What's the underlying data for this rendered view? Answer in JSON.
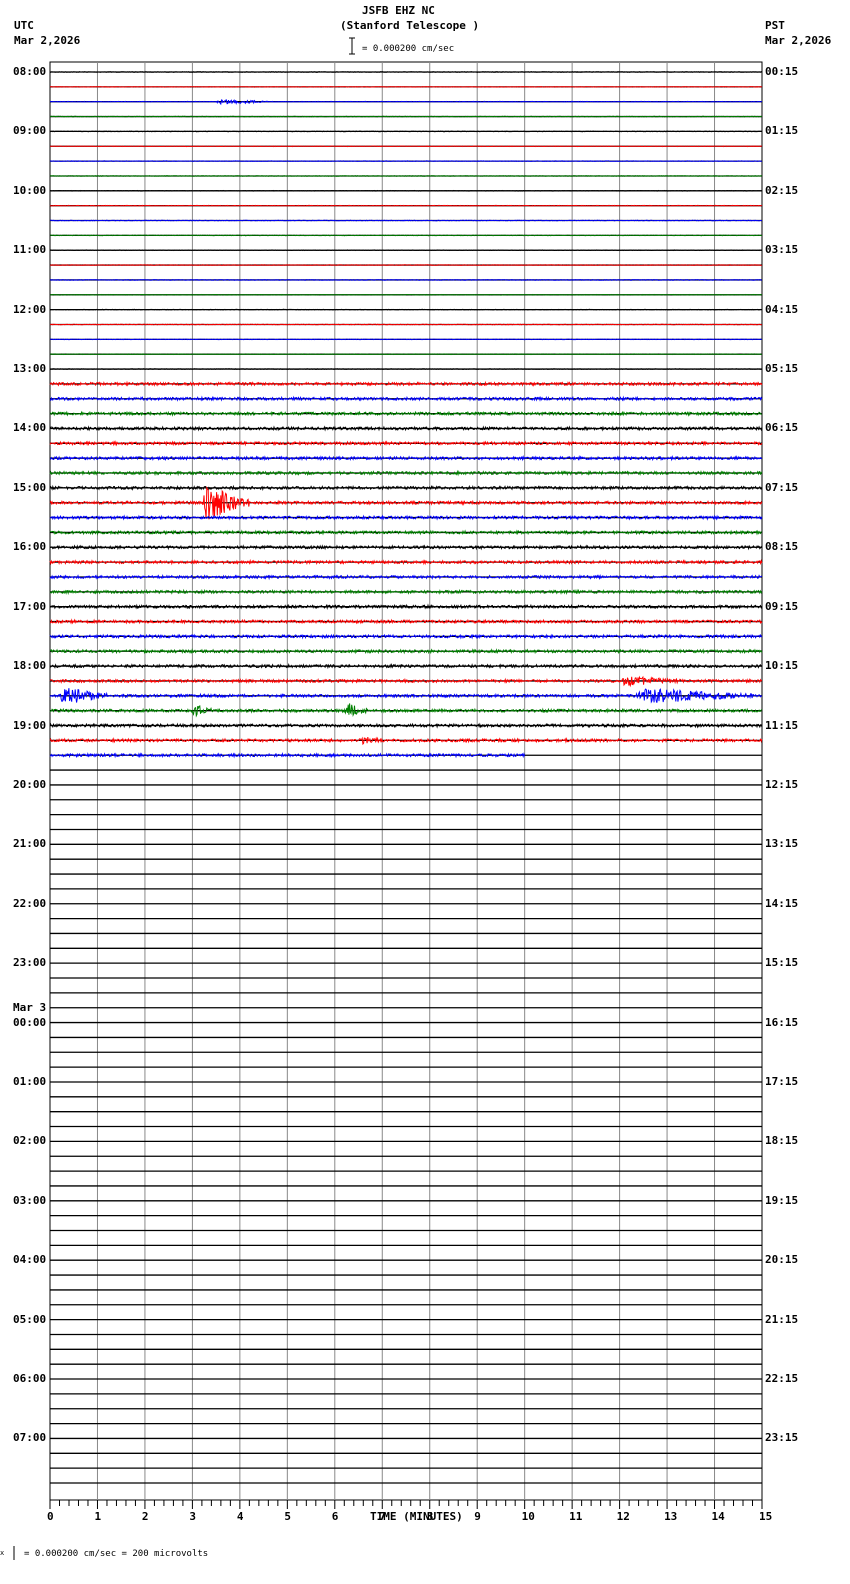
{
  "header": {
    "title": "JSFB EHZ NC",
    "subtitle": "(Stanford Telescope )",
    "left_tz": "UTC",
    "left_date": "Mar 2,2026",
    "right_tz": "PST",
    "right_date": "Mar 2,2026",
    "scale": "= 0.000200 cm/sec"
  },
  "footer": {
    "scale": "= 0.000200 cm/sec =     200 microvolts",
    "prefix": "x"
  },
  "chart_data": {
    "type": "line",
    "title": "JSFB EHZ NC (Stanford Telescope )",
    "xlabel": "TIME (MINUTES)",
    "xlim": [
      0,
      15
    ],
    "x_ticks": [
      "0",
      "1",
      "2",
      "3",
      "4",
      "5",
      "6",
      "7",
      "8",
      "9",
      "10",
      "11",
      "12",
      "13",
      "14",
      "15"
    ],
    "rows": 96,
    "row_minutes": 15,
    "colors": [
      "#000000",
      "#ff0000",
      "#0000ff",
      "#008000"
    ],
    "left_labels": [
      "08:00",
      "09:00",
      "10:00",
      "11:00",
      "12:00",
      "13:00",
      "14:00",
      "15:00",
      "16:00",
      "17:00",
      "18:00",
      "19:00",
      "20:00",
      "21:00",
      "22:00",
      "23:00",
      "00:00",
      "01:00",
      "02:00",
      "03:00",
      "04:00",
      "05:00",
      "06:00",
      "07:00"
    ],
    "date_change_label": "Mar 3",
    "right_labels": [
      "00:15",
      "01:15",
      "02:15",
      "03:15",
      "04:15",
      "05:15",
      "06:15",
      "07:15",
      "08:15",
      "09:15",
      "10:15",
      "11:15",
      "12:15",
      "13:15",
      "14:15",
      "15:15",
      "16:15",
      "17:15",
      "18:15",
      "19:15",
      "20:15",
      "21:15",
      "22:15",
      "23:15"
    ],
    "data_rows": 47,
    "last_row_end_minute": 10,
    "quiet_until_row": 20,
    "events": [
      {
        "row": 2,
        "start": 3.5,
        "end": 4.6,
        "amp": 3
      },
      {
        "row": 29,
        "start": 3.2,
        "end": 4.2,
        "amp": 18
      },
      {
        "row": 41,
        "start": 12.0,
        "end": 13.3,
        "amp": 4
      },
      {
        "row": 42,
        "start": 0.2,
        "end": 1.2,
        "amp": 9
      },
      {
        "row": 42,
        "start": 12.3,
        "end": 14.8,
        "amp": 7
      },
      {
        "row": 43,
        "start": 3.0,
        "end": 3.4,
        "amp": 6
      },
      {
        "row": 43,
        "start": 6.2,
        "end": 6.7,
        "amp": 8
      },
      {
        "row": 45,
        "start": 6.5,
        "end": 7.0,
        "amp": 3
      }
    ]
  }
}
